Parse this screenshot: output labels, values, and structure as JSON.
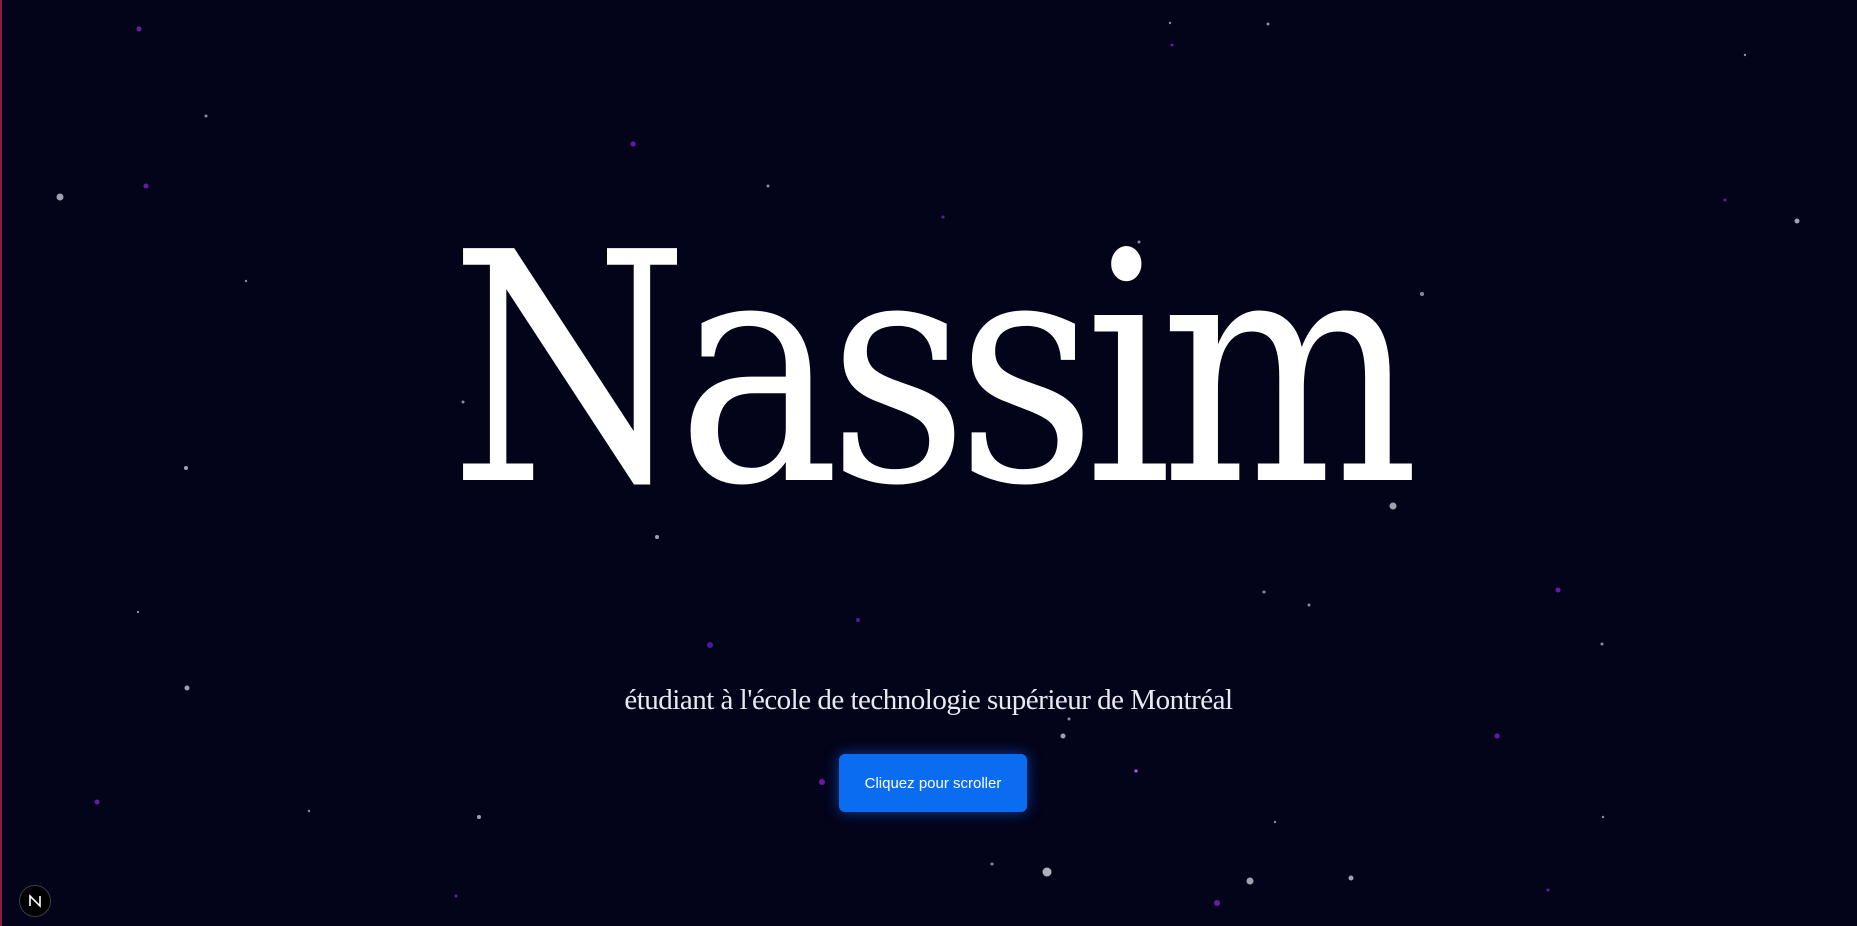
{
  "hero": {
    "title": "Nassim",
    "subtitle": "étudiant à l'école de technologie supérieur de Montréal"
  },
  "cta": {
    "label": "Cliquez pour scroller"
  },
  "dev_indicator": {
    "label": "N",
    "icon": "nextjs-logo-icon"
  },
  "colors": {
    "background": "#03041a",
    "accent_button": "#0a6cf0",
    "star_white": "#c8c8d8",
    "star_purple": "#6a1aa8",
    "edge_line": "#8a1f3a"
  }
}
